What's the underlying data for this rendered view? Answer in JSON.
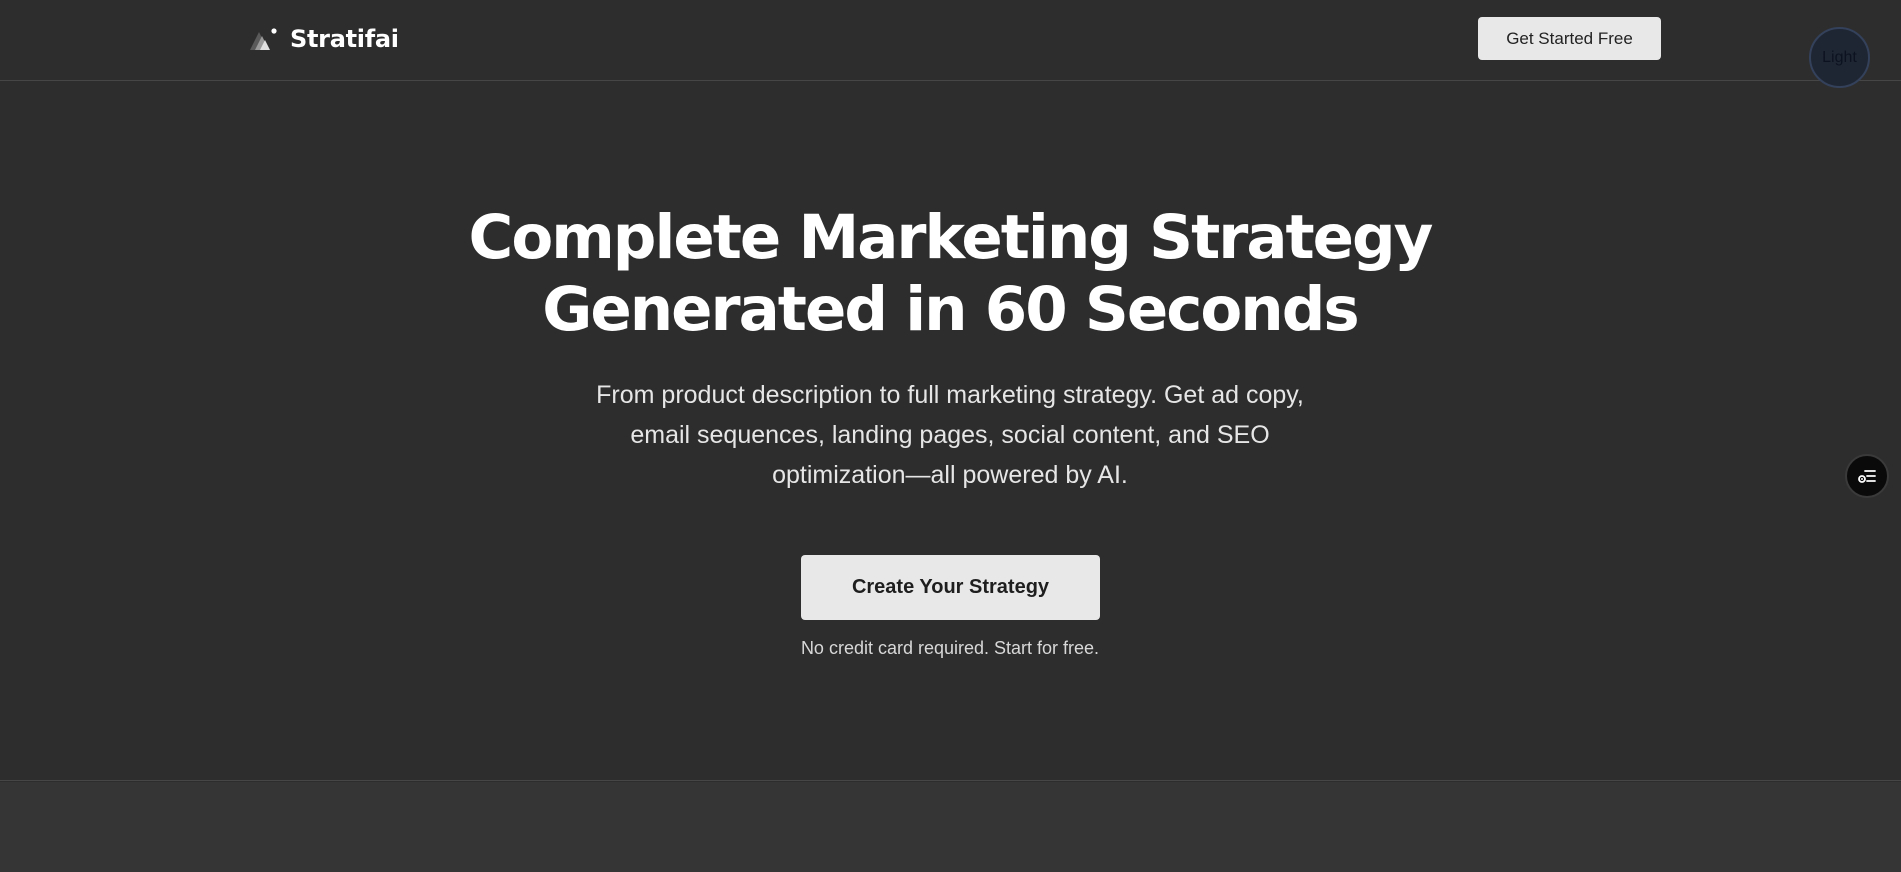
{
  "header": {
    "brand_name": "Stratifai",
    "logo_icon": "triangle-layers-logo",
    "cta_label": "Get Started Free",
    "theme_toggle_label": "Light"
  },
  "hero": {
    "title_line1": "Complete Marketing Strategy",
    "title_line2": "Generated in 60 Seconds",
    "subtitle": "From product description to full marketing strategy. Get ad copy, email sequences, landing pages, social content, and SEO optimization—all powered by AI.",
    "cta_label": "Create Your Strategy",
    "note": "No credit card required. Start for free."
  },
  "floating_widget": {
    "icon": "settings-list-icon"
  },
  "colors": {
    "background": "#2d2d2d",
    "lower_background": "#353535",
    "button_bg": "#e8e8e8",
    "button_text": "#222222",
    "text_primary": "#ffffff",
    "text_secondary": "#e6e6e6",
    "divider": "#464646",
    "toggle_bg": "#1f2633"
  }
}
